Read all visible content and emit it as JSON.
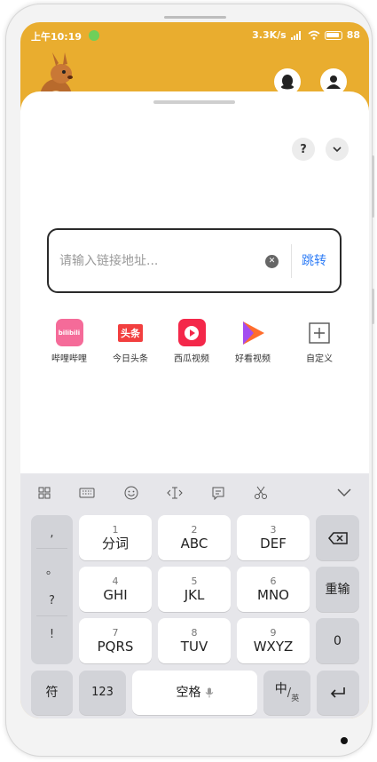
{
  "status_bar": {
    "time": "上午10:19",
    "network_speed": "3.3K/s",
    "battery": "88"
  },
  "sheet": {
    "help_label": "?",
    "collapse_label": "⌄"
  },
  "url_bar": {
    "placeholder": "请输入链接地址...",
    "value": "",
    "go_label": "跳转"
  },
  "shortcuts": [
    {
      "label": "哔哩哔哩",
      "icon": "bilibili-icon",
      "color": "#f56b99",
      "glyph": "bilibili"
    },
    {
      "label": "今日头条",
      "icon": "toutiao-icon",
      "color": "#f23f3f",
      "glyph": "头条"
    },
    {
      "label": "西瓜视频",
      "icon": "xigua-video-icon",
      "color": "#f4284a",
      "glyph": "▶"
    },
    {
      "label": "好看视频",
      "icon": "haokan-video-icon",
      "color": "#ff6d2d",
      "glyph": "▶"
    },
    {
      "label": "自定义",
      "icon": "add-icon",
      "color": "#666666",
      "glyph": "+"
    }
  ],
  "keyboard": {
    "toolbar": [
      "grid-icon",
      "keyboard-icon",
      "emoji-icon",
      "cursor-icon",
      "clipboard-icon",
      "scissors-icon",
      "hide-keyboard-icon"
    ],
    "punctuation": [
      ",",
      "。",
      "?",
      "!"
    ],
    "keys": {
      "k1": {
        "num": "1",
        "main": "分词"
      },
      "k2": {
        "num": "2",
        "main": "ABC"
      },
      "k3": {
        "num": "3",
        "main": "DEF"
      },
      "k4": {
        "num": "4",
        "main": "GHI"
      },
      "k5": {
        "num": "5",
        "main": "JKL"
      },
      "k6": {
        "num": "6",
        "main": "MNO"
      },
      "k7": {
        "num": "7",
        "main": "PQRS"
      },
      "k8": {
        "num": "8",
        "main": "TUV"
      },
      "k9": {
        "num": "9",
        "main": "WXYZ"
      }
    },
    "reenter": "重输",
    "zero": "0",
    "symbols": "符",
    "numbers": "123",
    "space": "空格",
    "lang_main": "中",
    "lang_sub": "英"
  },
  "colors": {
    "app_header": "#e9ad2f",
    "accent_blue": "#2f7df6"
  }
}
